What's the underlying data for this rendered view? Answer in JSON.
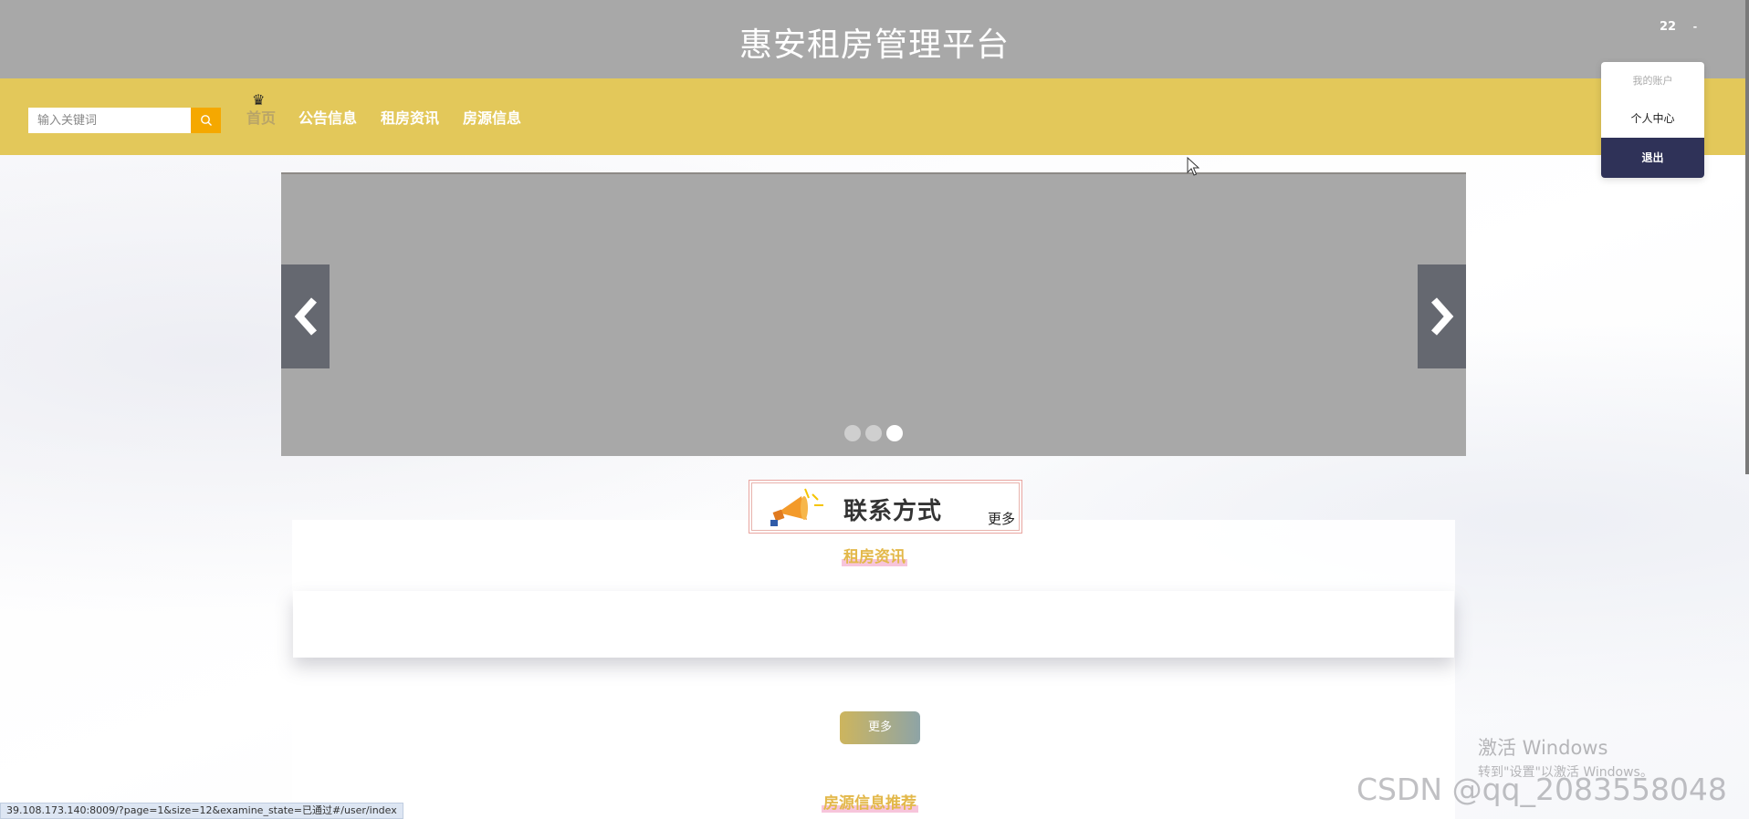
{
  "header": {
    "title": "惠安租房管理平台",
    "username": "22",
    "caret": "-"
  },
  "nav": {
    "search_placeholder": "输入关键词",
    "items": [
      {
        "label": "首页"
      },
      {
        "label": "公告信息"
      },
      {
        "label": "租房资讯"
      },
      {
        "label": "房源信息"
      }
    ]
  },
  "dropdown": {
    "header": "我的账户",
    "items": [
      {
        "label": "个人中心"
      }
    ],
    "logout": "退出"
  },
  "carousel": {
    "slide_count": 3,
    "active_index": 2
  },
  "contact": {
    "title": "联系方式",
    "more": "更多"
  },
  "sections": {
    "news_title": "租房资讯",
    "more_button": "更多",
    "houses_title": "房源信息推荐"
  },
  "status": {
    "url": "39.108.173.140:8009/?page=1&size=12&examine_state=已通过#/user/index"
  },
  "watermarks": {
    "windows_title": "激活 Windows",
    "windows_sub": "转到\"设置\"以激活 Windows。",
    "csdn": "CSDN @qq_2083558048"
  },
  "colors": {
    "topbar": "#a8a8a8",
    "navbar": "#e3c85a",
    "search_button": "#f5a800",
    "logout_bg": "#2f3258",
    "section_title": "#e3b84a"
  }
}
